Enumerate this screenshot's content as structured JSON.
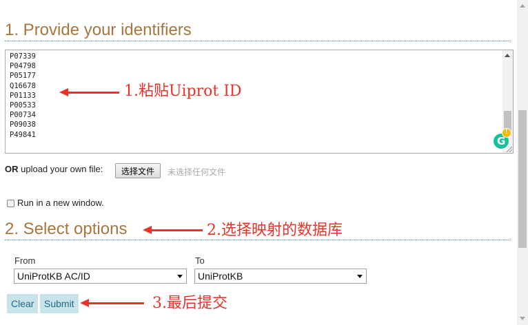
{
  "section1": {
    "title": "1. Provide your identifiers"
  },
  "identifiers": [
    "P07339",
    "P04798",
    "P05177",
    "Q16678",
    "P01133",
    "P00533",
    "P00734",
    "P09038",
    "P49841"
  ],
  "annotations": {
    "paste": "1.粘贴Uiprot ID",
    "select_db": "2.选择映射的数据库",
    "submit": "3.最后提交"
  },
  "upload": {
    "or_label": "OR",
    "label": "upload your own file:",
    "button_label": "选择文件",
    "status": "未选择任何文件"
  },
  "new_window": {
    "label": "Run in a new window.",
    "checked": false
  },
  "section2": {
    "title": "2. Select options"
  },
  "from": {
    "label": "From",
    "value": "UniProtKB AC/ID"
  },
  "to": {
    "label": "To",
    "value": "UniProtKB"
  },
  "buttons": {
    "clear": "Clear",
    "submit": "Submit"
  },
  "colors": {
    "heading": "#a8763d",
    "annotation": "#e8332a",
    "button_bg": "#c9e3ea",
    "button_text": "#1f6a8a"
  }
}
